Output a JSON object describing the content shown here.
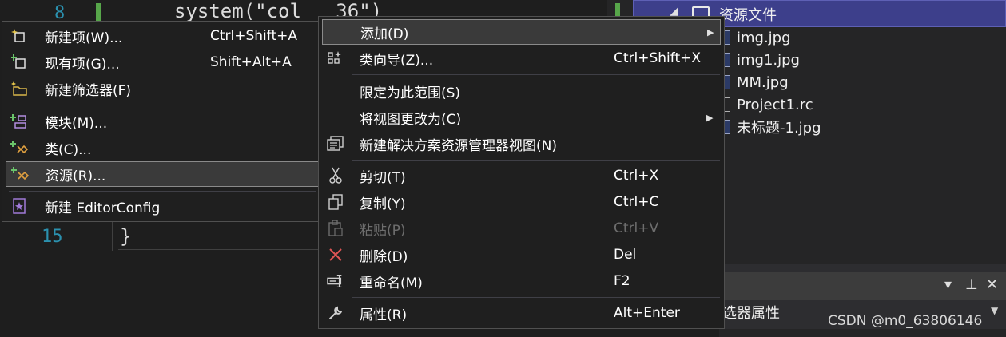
{
  "editor": {
    "top_line_number": "8",
    "top_code": "system(\"col   36\")",
    "bottom_line_number": "15",
    "bottom_code": "}"
  },
  "solution_explorer": {
    "folder_label": "资源文件",
    "files": [
      "img.jpg",
      "img1.jpg",
      "MM.jpg",
      "Project1.rc",
      "未标题-1.jpg"
    ]
  },
  "properties_panel": {
    "title": "选器属性",
    "buttons": {
      "dropdown": "▾",
      "pin": "⊥",
      "close": "✕"
    }
  },
  "watermark": "CSDN @m0_63806146",
  "add_submenu": {
    "items": [
      {
        "label": "新建项(W)...",
        "shortcut": "Ctrl+Shift+A",
        "icon": "new-item-icon"
      },
      {
        "label": "现有项(G)...",
        "shortcut": "Shift+Alt+A",
        "icon": "existing-item-icon"
      },
      {
        "label": "新建筛选器(F)",
        "shortcut": "",
        "icon": "new-filter-icon"
      },
      {
        "label": "模块(M)...",
        "shortcut": "",
        "icon": "module-icon"
      },
      {
        "label": "类(C)...",
        "shortcut": "",
        "icon": "class-icon"
      },
      {
        "label": "资源(R)...",
        "shortcut": "",
        "icon": "resource-icon"
      },
      {
        "label": "新建 EditorConfig",
        "shortcut": "",
        "icon": "editorconfig-icon"
      }
    ]
  },
  "context_menu": {
    "items": [
      {
        "label": "添加(D)",
        "shortcut": "",
        "icon": ""
      },
      {
        "label": "类向导(Z)...",
        "shortcut": "Ctrl+Shift+X",
        "icon": "class-wizard-icon"
      },
      {
        "label": "限定为此范围(S)",
        "shortcut": "",
        "icon": ""
      },
      {
        "label": "将视图更改为(C)",
        "shortcut": "",
        "icon": ""
      },
      {
        "label": "新建解决方案资源管理器视图(N)",
        "shortcut": "",
        "icon": "new-view-icon"
      },
      {
        "label": "剪切(T)",
        "shortcut": "Ctrl+X",
        "icon": "cut-icon"
      },
      {
        "label": "复制(Y)",
        "shortcut": "Ctrl+C",
        "icon": "copy-icon"
      },
      {
        "label": "粘贴(P)",
        "shortcut": "Ctrl+V",
        "icon": "paste-icon"
      },
      {
        "label": "删除(D)",
        "shortcut": "Del",
        "icon": "delete-icon"
      },
      {
        "label": "重命名(M)",
        "shortcut": "F2",
        "icon": "rename-icon"
      },
      {
        "label": "属性(R)",
        "shortcut": "Alt+Enter",
        "icon": "properties-icon"
      }
    ]
  },
  "colors": {
    "accent_purple": "#3d3f8b",
    "delete_red": "#e05555",
    "line_number": "#2b91af"
  }
}
